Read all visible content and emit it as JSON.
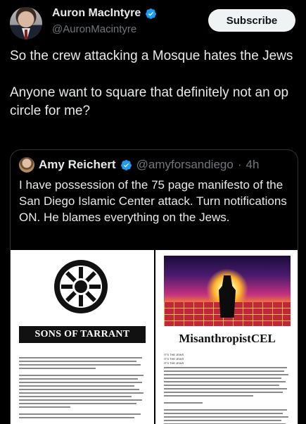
{
  "author": {
    "display_name": "Auron MacIntyre",
    "handle": "@AuronMacintyre",
    "verified_icon": "verified-badge-icon",
    "avatar_icon": "profile-avatar"
  },
  "subscribe_label": "Subscribe",
  "tweet": {
    "paragraph1": "So the crew attacking a Mosque hates the Jews",
    "paragraph2": "Anyone want to square that definitely not an op circle for me?"
  },
  "quoted": {
    "display_name": "Amy Reichert",
    "handle": "@amyforsandiego",
    "separator": "·",
    "time": "4h",
    "text": "I have possession of the 75 page manifesto of the San Diego Islamic Center attack. Turn notifications ON. He blames everything on the Jews.",
    "documents": [
      {
        "title": "SONS OF TARRANT",
        "image": "black-sun-emblem"
      },
      {
        "title": "MisanthropistCEL",
        "image": "synthwave-figure-art",
        "header_lines": [
          "IT'S THE JEWS",
          "IT'S THE JEWS",
          "IT'S THE JEWS"
        ]
      }
    ]
  },
  "colors": {
    "background": "#000000",
    "text": "#e7e9ea",
    "muted": "#71767b",
    "verified": "#1d9bf0",
    "border": "#2f3336"
  }
}
